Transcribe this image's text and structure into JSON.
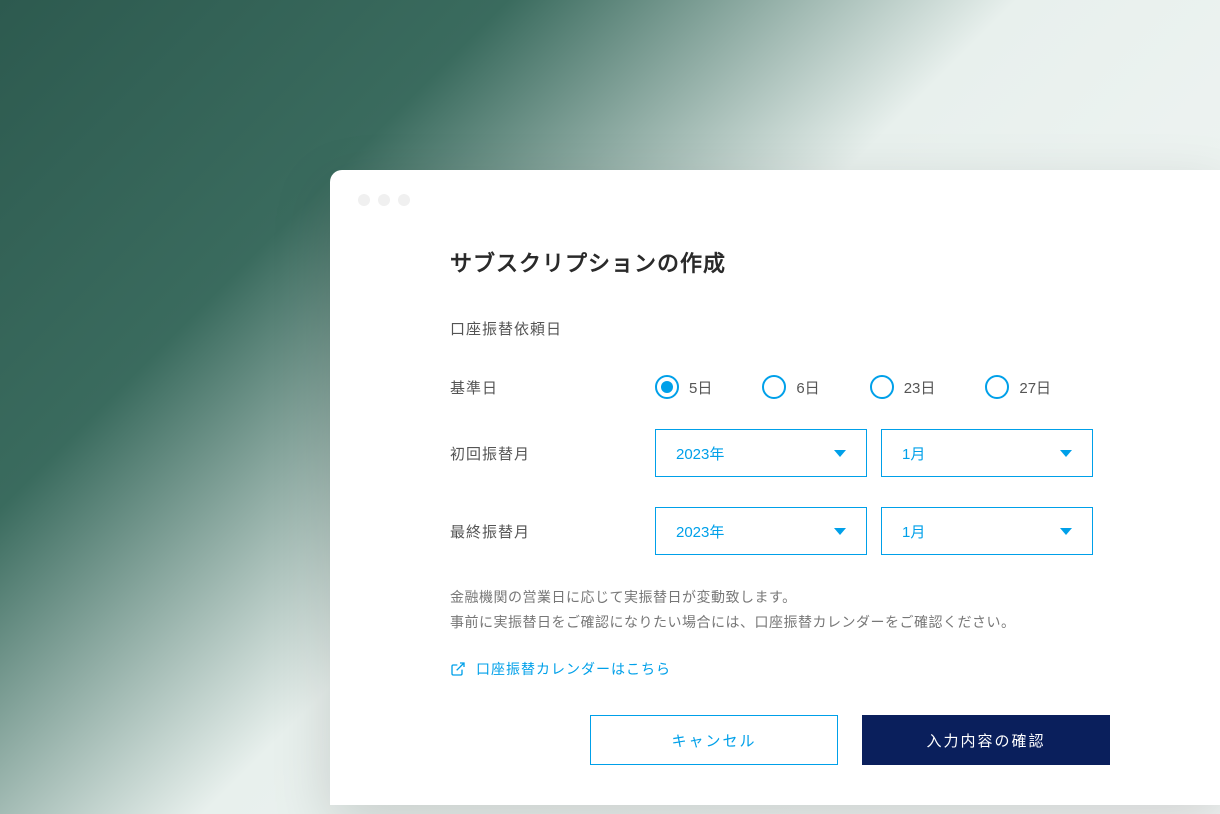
{
  "page": {
    "title": "サブスクリプションの作成"
  },
  "section": {
    "subtitle": "口座振替依頼日"
  },
  "form": {
    "base_date_label": "基準日",
    "first_month_label": "初回振替月",
    "last_month_label": "最終振替月",
    "radio_options": [
      {
        "label": "5日",
        "selected": true
      },
      {
        "label": "6日",
        "selected": false
      },
      {
        "label": "23日",
        "selected": false
      },
      {
        "label": "27日",
        "selected": false
      }
    ],
    "first_year": "2023年",
    "first_month": "1月",
    "last_year": "2023年",
    "last_month": "1月"
  },
  "note": {
    "line1": "金融機関の営業日に応じて実振替日が変動致します。",
    "line2": "事前に実振替日をご確認になりたい場合には、口座振替カレンダーをご確認ください。"
  },
  "link": {
    "calendar": "口座振替カレンダーはこちら"
  },
  "buttons": {
    "cancel": "キャンセル",
    "confirm": "入力内容の確認"
  }
}
